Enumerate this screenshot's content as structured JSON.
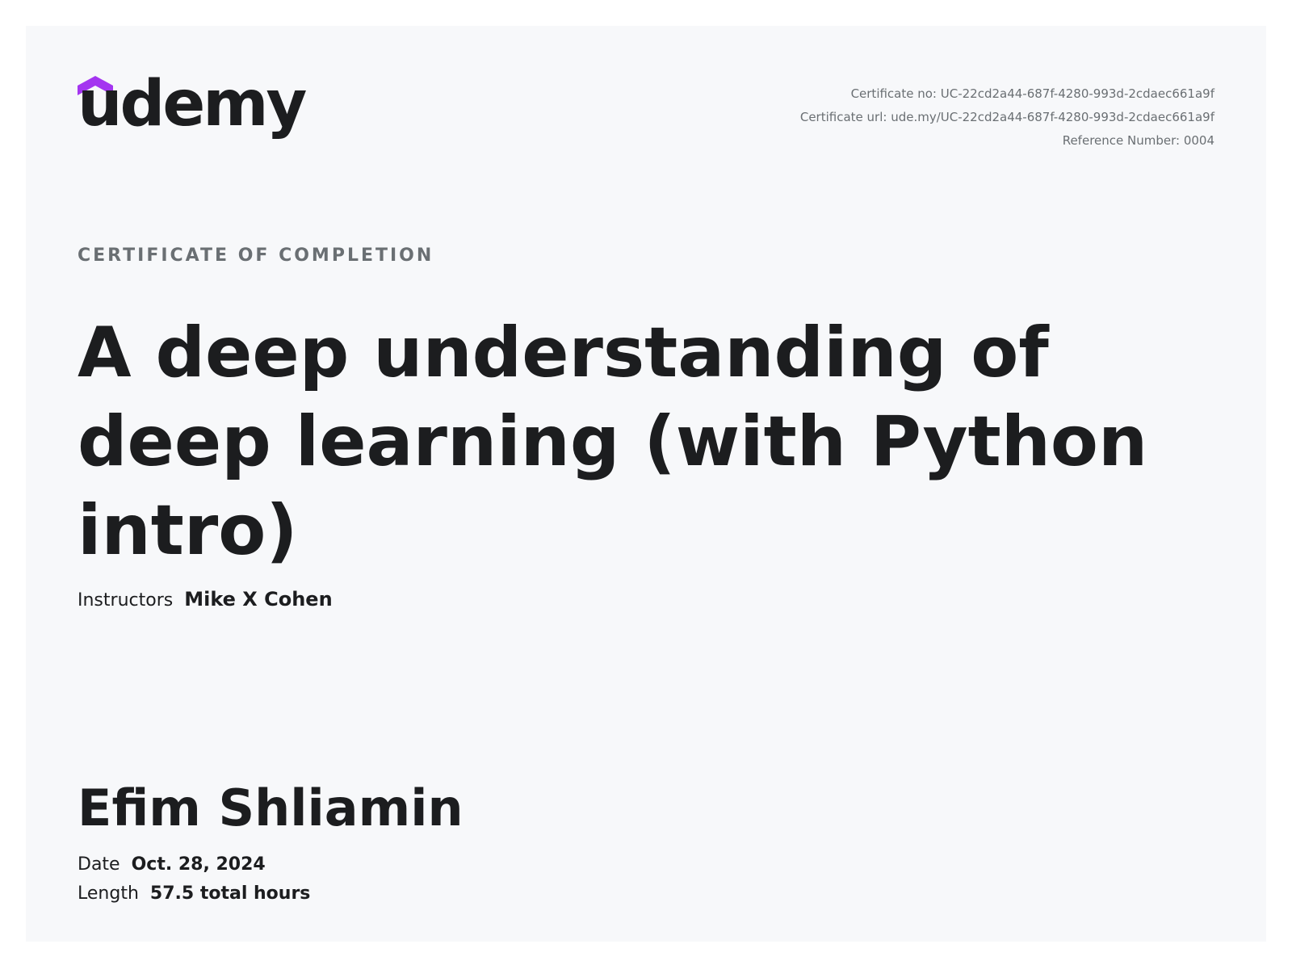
{
  "brand": {
    "name": "udemy",
    "accent_color": "#a435f0",
    "logo_icon": "udemy-cap-icon"
  },
  "meta": {
    "certificate_no": "Certificate no: UC-22cd2a44-687f-4280-993d-2cdaec661a9f",
    "certificate_url": "Certificate url: ude.my/UC-22cd2a44-687f-4280-993d-2cdaec661a9f",
    "reference_number": "Reference Number: 0004"
  },
  "certificate": {
    "label": "CERTIFICATE OF COMPLETION",
    "course_title": "A deep understanding of deep learning (with Python intro)",
    "instructors_label": "Instructors",
    "instructors_value": "Mike X Cohen",
    "student_name": "Efim Shliamin",
    "date_label": "Date",
    "date_value": "Oct. 28, 2024",
    "length_label": "Length",
    "length_value": "57.5 total hours"
  }
}
